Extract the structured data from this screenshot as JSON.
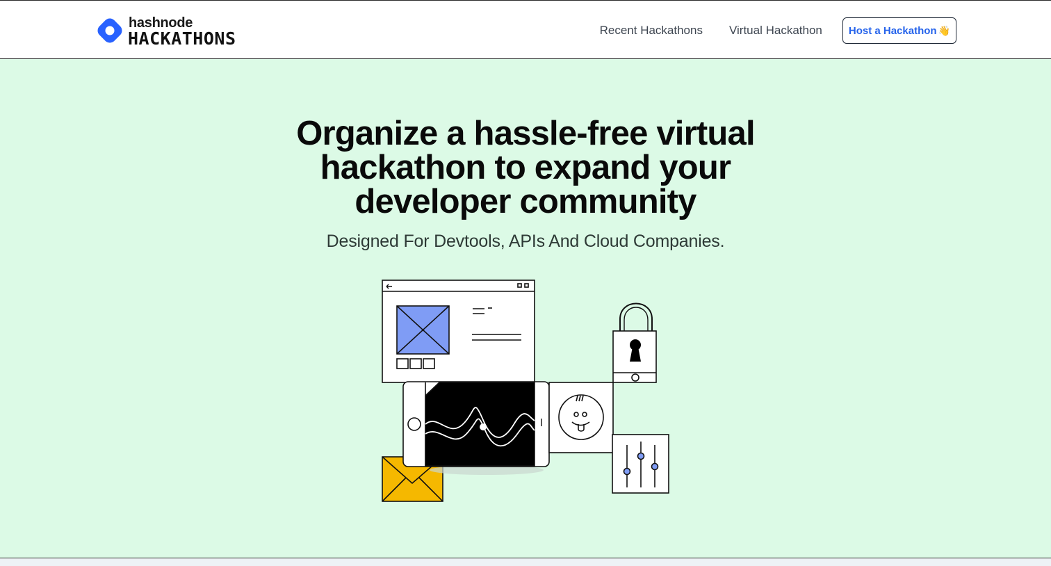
{
  "header": {
    "logo_small": "hashnode",
    "logo_big": "HACKATHONS",
    "nav": {
      "recent": "Recent Hackathons",
      "virtual": "Virtual Hackathon",
      "host": "Host a Hackathon",
      "host_emoji": "👋"
    }
  },
  "hero": {
    "headline": "Organize a hassle-free virtual hackathon to expand your developer community",
    "subline": "Designed For Devtools, APIs And Cloud Companies."
  },
  "colors": {
    "brand": "#2962ff",
    "hero_bg": "#dcfae6",
    "link_blue": "#2563eb",
    "envelope": "#f5b800",
    "image_blue": "#7f9cf5"
  },
  "icons": {
    "logo": "hashnode-logo-icon",
    "illustration": "hackathon-devices-illustration"
  }
}
